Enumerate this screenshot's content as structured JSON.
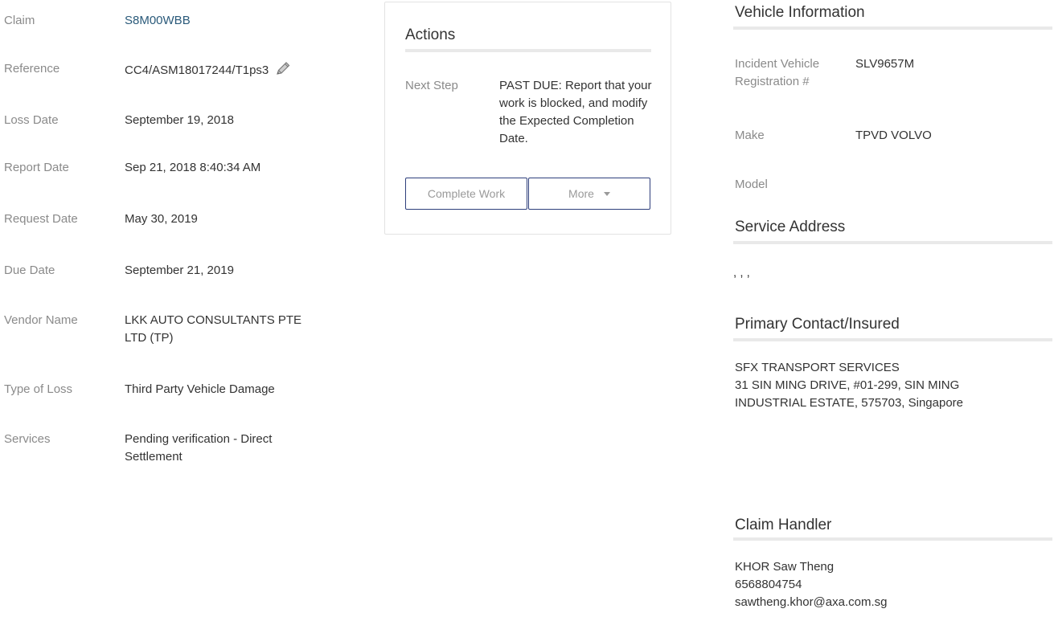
{
  "details": {
    "claim": {
      "label": "Claim",
      "value": "S8M00WBB"
    },
    "reference": {
      "label": "Reference",
      "value": "CC4/ASM18017244/T1ps3"
    },
    "loss_date": {
      "label": "Loss Date",
      "value": "September 19, 2018"
    },
    "report_date": {
      "label": "Report Date",
      "value": "Sep 21, 2018 8:40:34 AM"
    },
    "request_date": {
      "label": "Request Date",
      "value": "May 30, 2019"
    },
    "due_date": {
      "label": "Due Date",
      "value": "September 21, 2019"
    },
    "vendor_name": {
      "label": "Vendor Name",
      "value": "LKK AUTO CONSULTANTS PTE LTD (TP)"
    },
    "type_of_loss": {
      "label": "Type of Loss",
      "value": "Third Party Vehicle Damage"
    },
    "services": {
      "label": "Services",
      "value": "Pending verification - Direct Settlement"
    }
  },
  "actions": {
    "title": "Actions",
    "next_step_label": "Next Step",
    "next_step_value": "PAST DUE: Report that your work is blocked, and modify the Expected Completion Date.",
    "complete_work_label": "Complete Work",
    "more_label": "More"
  },
  "vehicle": {
    "title": "Vehicle Information",
    "registration_label": "Incident Vehicle Registration #",
    "registration_value": "SLV9657M",
    "make_label": "Make",
    "make_value": "TPVD VOLVO",
    "model_label": "Model",
    "model_value": ""
  },
  "service_address": {
    "title": "Service Address",
    "value": ", , ,"
  },
  "primary_contact": {
    "title": "Primary Contact/Insured",
    "name": "SFX TRANSPORT SERVICES",
    "address": "31 SIN MING DRIVE, #01-299, SIN MING INDUSTRIAL ESTATE, 575703, Singapore"
  },
  "claim_handler": {
    "title": "Claim Handler",
    "name": "KHOR Saw Theng",
    "phone": "6568804754",
    "email": "sawtheng.khor@axa.com.sg"
  },
  "colors": {
    "link": "#2a5a7a",
    "button_border": "#2e3f7c",
    "label": "#8a8a8a",
    "rule": "#e9e9e9"
  },
  "icons": {
    "reference_edit": "pencil-icon",
    "more_dropdown": "caret-down-icon"
  }
}
